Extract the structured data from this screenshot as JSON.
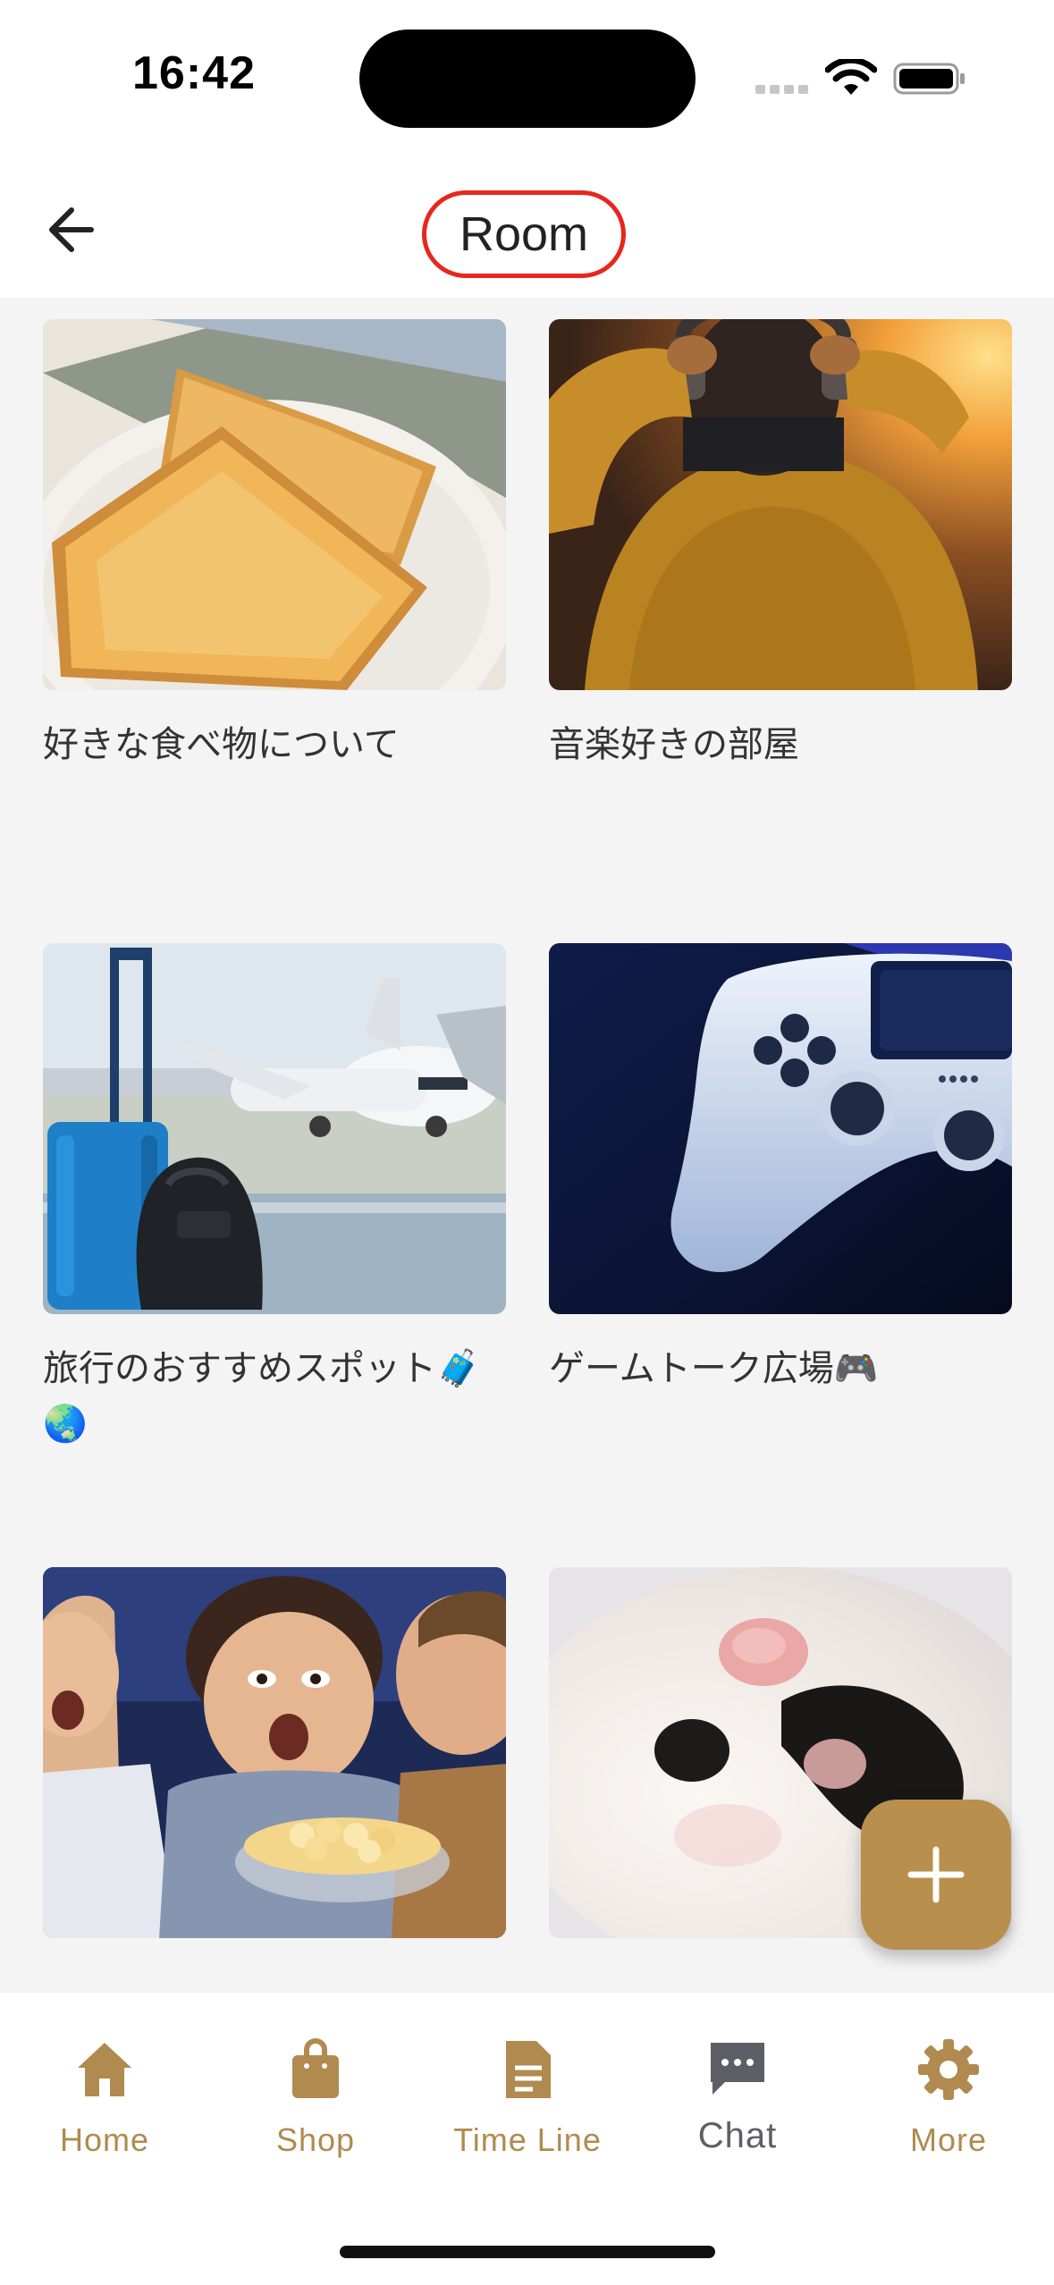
{
  "status_bar": {
    "time": "16:42",
    "icons": [
      "cellular-signal-icon",
      "wifi-icon",
      "battery-icon"
    ]
  },
  "header": {
    "title": "Room",
    "back_icon": "arrow-left-icon",
    "highlight_color": "#e8261e"
  },
  "rooms": [
    {
      "title": "好きな食べ物について",
      "image": "toast-photo"
    },
    {
      "title": "音楽好きの部屋",
      "image": "headphones-photo"
    },
    {
      "title": "旅行のおすすめスポット🧳🌏",
      "image": "airport-luggage-photo"
    },
    {
      "title": "ゲームトーク広場🎮",
      "image": "game-controller-photo"
    },
    {
      "title": "",
      "image": "kids-popcorn-photo"
    },
    {
      "title": "",
      "image": "cat-paw-photo"
    }
  ],
  "fab": {
    "icon": "plus-icon",
    "color": "#b88f4c"
  },
  "tabs": [
    {
      "label": "Home",
      "icon": "home-icon"
    },
    {
      "label": "Shop",
      "icon": "shopping-bag-icon"
    },
    {
      "label": "Time Line",
      "icon": "document-icon"
    },
    {
      "label": "Chat",
      "icon": "chat-bubble-icon",
      "active": true
    },
    {
      "label": "More",
      "icon": "gear-icon"
    }
  ],
  "colors": {
    "accent": "#b08a4f",
    "active_tab": "#5e5e66",
    "background": "#f4f4f4"
  }
}
